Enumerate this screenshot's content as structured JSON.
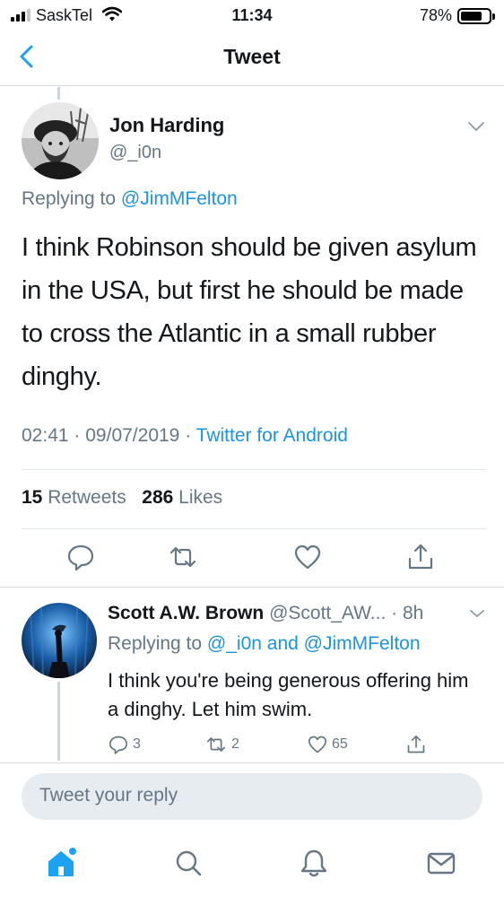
{
  "status_bar": {
    "carrier": "SaskTel",
    "time": "11:34",
    "battery_percent": "78%",
    "battery_level": 0.78,
    "signal_bars": 3,
    "signal_bars_total": 4
  },
  "nav": {
    "title": "Tweet",
    "back_icon": "chevron-left-icon"
  },
  "tweet": {
    "author_name": "Jon Harding",
    "author_handle": "@_i0n",
    "replying_prefix": "Replying to",
    "replying_to": "@JimMFelton",
    "text": "I think Robinson should be given asylum in the USA,  but first he should be made to cross the Atlantic in a small rubber dinghy.",
    "time": "02:41",
    "date": "09/07/2019",
    "source": "Twitter for Android",
    "retweets_count": "15",
    "retweets_label": "Retweets",
    "likes_count": "286",
    "likes_label": "Likes",
    "actions": [
      "reply-icon",
      "retweet-icon",
      "like-icon",
      "share-icon"
    ]
  },
  "reply": {
    "author_name": "Scott A.W. Brown",
    "author_handle": "@Scott_AW...",
    "time_ago": "· 8h",
    "replying_prefix": "Replying to",
    "replying_to_1": "@_i0n",
    "replying_and": "and",
    "replying_to_2": "@JimMFelton",
    "text": "I think you're being generous offering him a dinghy. Let him swim.",
    "reply_count": "3",
    "retweet_count": "2",
    "like_count": "65"
  },
  "compose": {
    "placeholder": "Tweet your reply"
  },
  "tab_bar": {
    "items": [
      "home-icon",
      "search-icon",
      "notifications-icon",
      "messages-icon"
    ]
  },
  "colors": {
    "accent": "#1da1f2",
    "link": "#1b95e0",
    "secondary_text": "#657786",
    "primary_text": "#14171a"
  }
}
